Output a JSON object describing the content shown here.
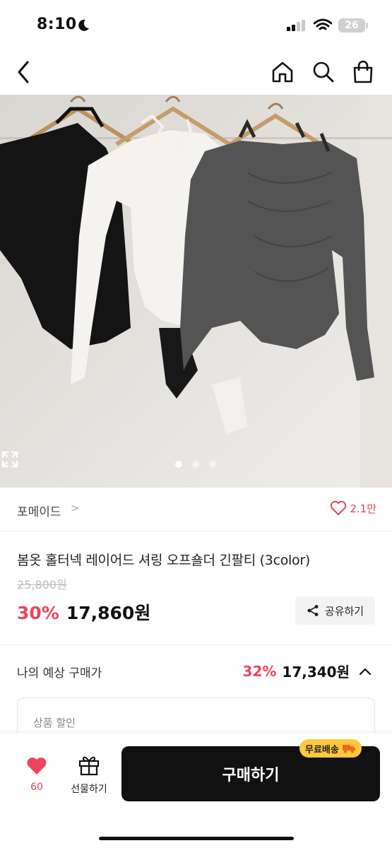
{
  "status": {
    "time": "8:10",
    "battery": "26"
  },
  "nav": {
    "back_icon": "chevron-left-icon",
    "home_icon": "home-icon",
    "search_icon": "search-icon",
    "cart_icon": "shopping-bag-icon"
  },
  "gallery": {
    "image_count": 3,
    "active_index": 0,
    "subject": "three off-shoulder halter long sleeve tops on hangers (black, white, charcoal)"
  },
  "brand": {
    "name": "포메이드",
    "chevron": ">",
    "like_count": "2.1만"
  },
  "product": {
    "title": "봄옷 홀터넥 레이어드 셔링 오프숄더 긴팔티 (3color)",
    "original_price": "25,800원",
    "discount": "30%",
    "price": "17,860원",
    "share_label": "공유하기"
  },
  "expected": {
    "label": "나의 예상 구매가",
    "discount": "32%",
    "price": "17,340원"
  },
  "discount_card": {
    "label": "상품 할인"
  },
  "bottom": {
    "wish_count": "60",
    "gift_label": "선물하기",
    "buy_label": "구매하기",
    "shipping_badge": "무료배송"
  },
  "colors": {
    "accent": "#f0445c",
    "buy_button": "#111111",
    "badge": "#ffc83d"
  }
}
